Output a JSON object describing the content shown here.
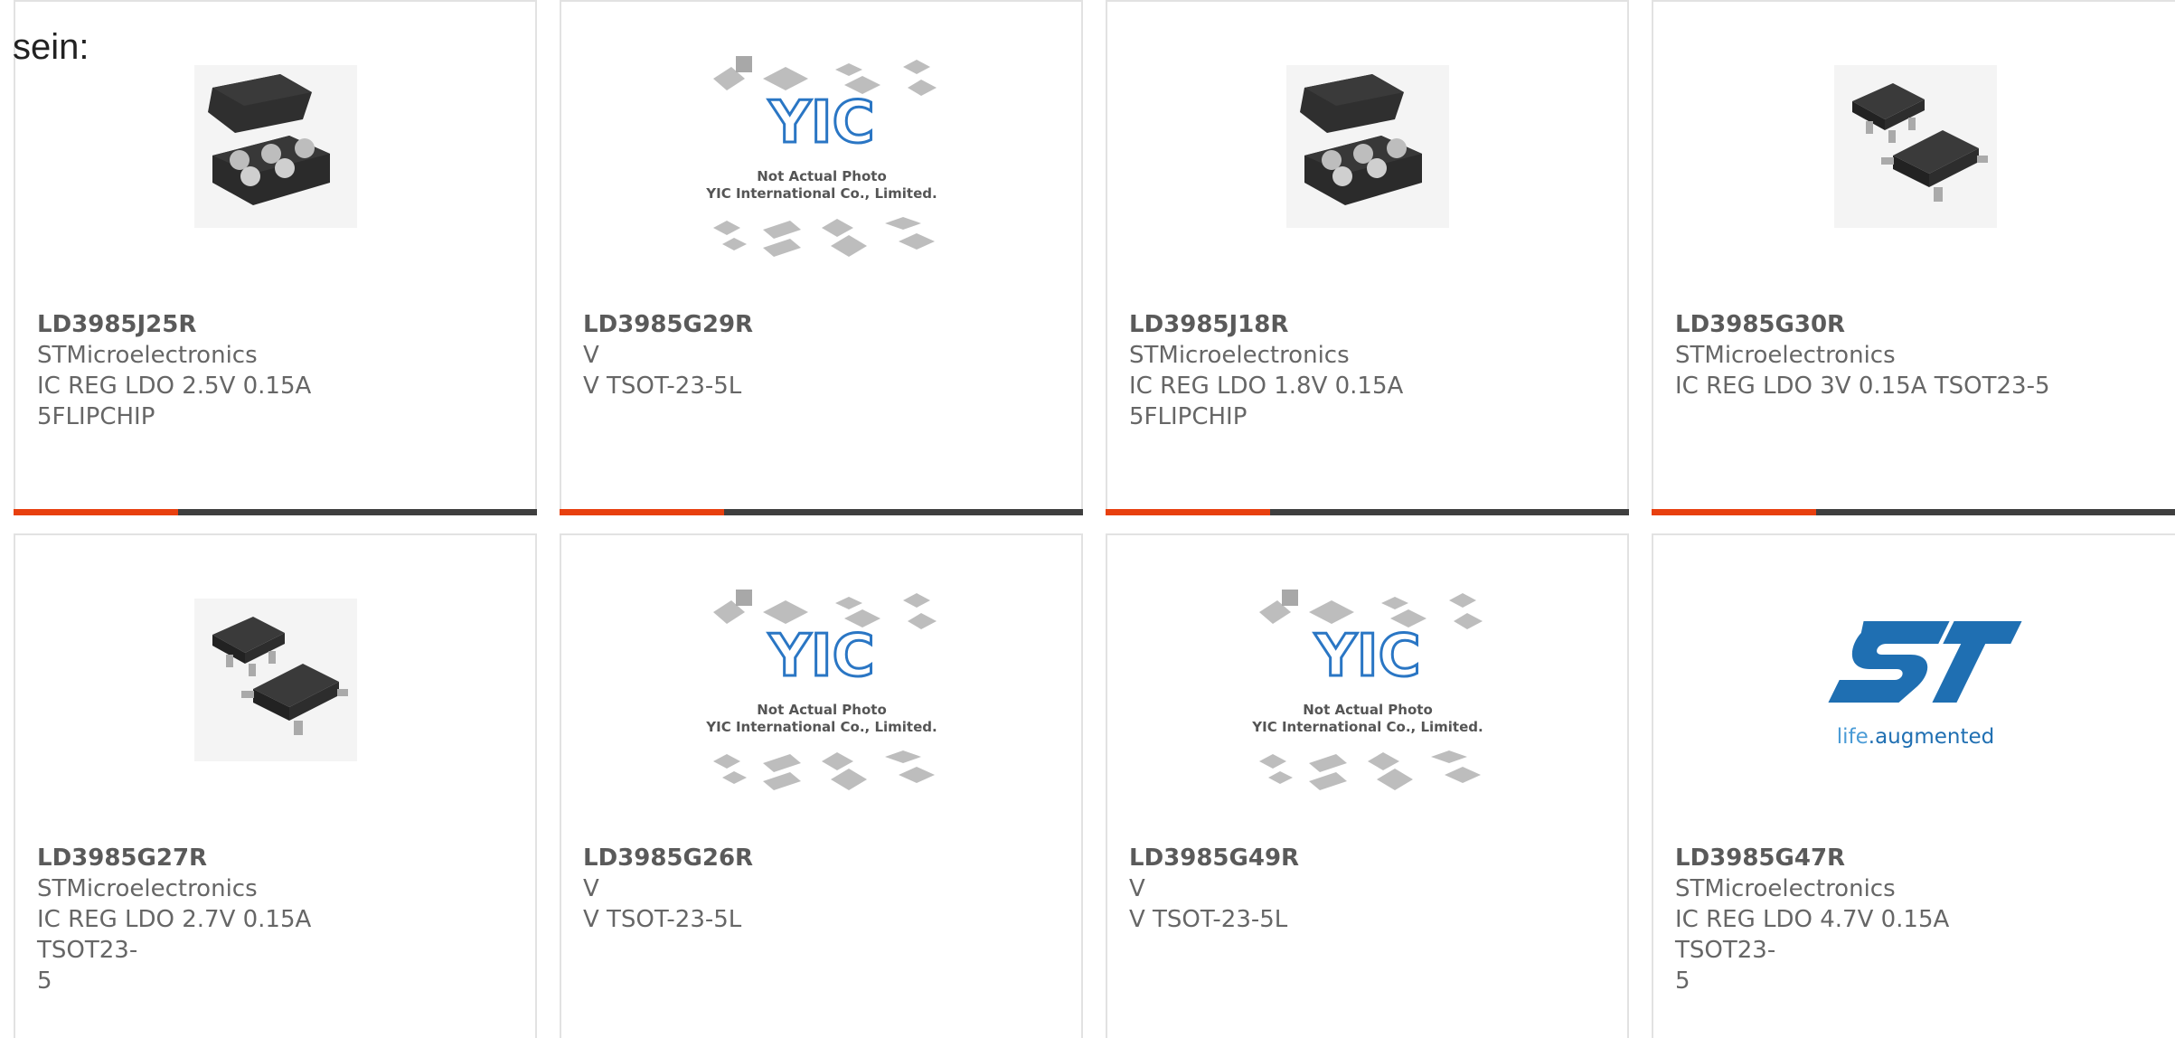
{
  "intro_text": "sein:",
  "products": [
    {
      "part": "LD3985J25R",
      "maker": "STMicroelectronics",
      "desc_line1": "IC REG LDO 2.5V 0.15A",
      "desc_line2": "5FLIPCHIP",
      "image": "flipchip-package-icon"
    },
    {
      "part": "LD3985G29R",
      "maker": "V",
      "desc_line1": "V TSOT-23-5L",
      "desc_line2": "",
      "image": "not-actual-photo-placeholder"
    },
    {
      "part": "LD3985J18R",
      "maker": "STMicroelectronics",
      "desc_line1": "IC REG LDO 1.8V 0.15A",
      "desc_line2": "5FLIPCHIP",
      "image": "flipchip-package-icon"
    },
    {
      "part": "LD3985G30R",
      "maker": "STMicroelectronics",
      "desc_line1": "IC REG LDO 3V 0.15A TSOT23-5",
      "desc_line2": "",
      "image": "sot23-package-icon"
    },
    {
      "part": "LD3985G27R",
      "maker": "STMicroelectronics",
      "desc_line1": "IC REG LDO 2.7V 0.15A TSOT23-",
      "desc_line2": "5",
      "image": "sot23-package-icon"
    },
    {
      "part": "LD3985G26R",
      "maker": "V",
      "desc_line1": "V TSOT-23-5L",
      "desc_line2": "",
      "image": "not-actual-photo-placeholder"
    },
    {
      "part": "LD3985G49R",
      "maker": "V",
      "desc_line1": "V TSOT-23-5L",
      "desc_line2": "",
      "image": "not-actual-photo-placeholder"
    },
    {
      "part": "LD3985G47R",
      "maker": "STMicroelectronics",
      "desc_line1": "IC REG LDO 4.7V 0.15A TSOT23-",
      "desc_line2": "5",
      "image": "st-logo"
    }
  ],
  "placeholder_text": {
    "line1": "Not Actual Photo",
    "line2": "YIC International Co., Limited.",
    "logo": "YIC"
  },
  "st_logo_text": {
    "mark": "ST",
    "tagline_left": "life",
    "tagline_dot": ".",
    "tagline_right": "augmented"
  },
  "colors": {
    "accent": "#e8400f",
    "bar": "#3f3f3f",
    "border": "#e2e2e2",
    "text": "#666666",
    "st_blue": "#1f6fb2"
  }
}
